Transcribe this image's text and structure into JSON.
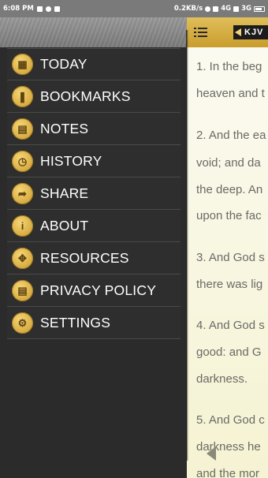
{
  "status_bar": {
    "time": "6:08 PM",
    "network_speed": "0.2KB/s",
    "network_type": "4G",
    "secondary_network": "3G"
  },
  "header": {
    "menu_icon": "hamburger-list-icon",
    "version_label": "KJV"
  },
  "drawer": {
    "items": [
      {
        "label": "TODAY",
        "icon": "calendar-icon",
        "glyph": "▦"
      },
      {
        "label": "BOOKMARKS",
        "icon": "bookmark-icon",
        "glyph": "❚"
      },
      {
        "label": "NOTES",
        "icon": "notes-icon",
        "glyph": "▤"
      },
      {
        "label": "HISTORY",
        "icon": "history-clock-icon",
        "glyph": "◷"
      },
      {
        "label": "SHARE",
        "icon": "share-icon",
        "glyph": "➦"
      },
      {
        "label": "ABOUT",
        "icon": "info-icon",
        "glyph": "i"
      },
      {
        "label": "RESOURCES",
        "icon": "resources-arrows-icon",
        "glyph": "✥"
      },
      {
        "label": "PRIVACY POLICY",
        "icon": "privacy-document-icon",
        "glyph": "▤"
      },
      {
        "label": "SETTINGS",
        "icon": "gear-icon",
        "glyph": "⚙"
      }
    ]
  },
  "content": {
    "verses": [
      "1. In the beg",
      "heaven and t",
      "2. And the ea",
      "void; and da",
      "the deep. An",
      "upon the fac",
      "3. And God s",
      "there was lig",
      "4. And God s",
      "good: and G",
      "darkness.",
      "5. And God c",
      "darkness he",
      "and the mor"
    ]
  },
  "colors": {
    "accent_gold": "#d4ab3f",
    "drawer_bg": "#2b2b2b",
    "content_bg": "#f8f6e0"
  }
}
